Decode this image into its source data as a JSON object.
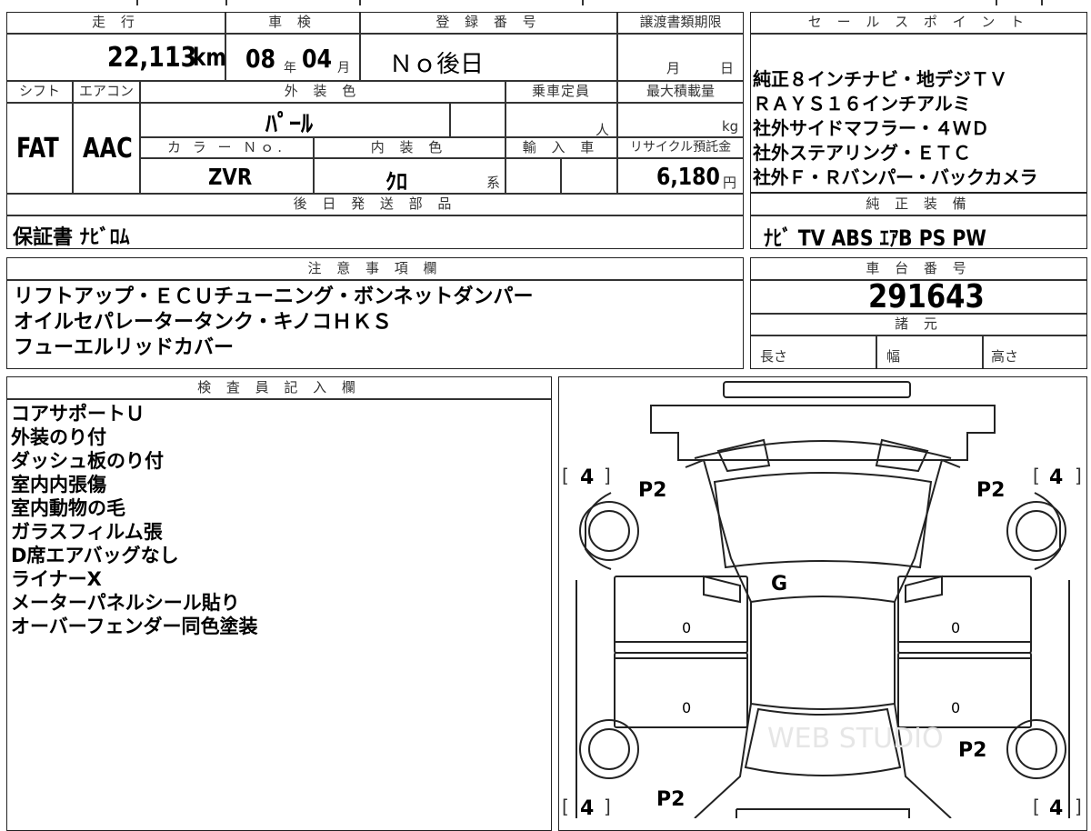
{
  "header": {
    "mileage_label": "走 行",
    "inspection_label": "車 検",
    "registration_label": "登 録 番 号",
    "transfer_deadline_label": "譲渡書類期限",
    "sales_points_label": "セ ー ル ス ポ イ ン ト"
  },
  "vehicle": {
    "mileage": "22,113",
    "mileage_unit": "km",
    "inspection_year": "08",
    "inspection_year_unit": "年",
    "inspection_month": "04",
    "inspection_month_unit": "月",
    "registration": "Ｎｏ後日",
    "transfer_month_unit": "月",
    "transfer_day_unit": "日"
  },
  "specs": {
    "shift_label": "シフト",
    "aircon_label": "エアコン",
    "exterior_color_label": "外 装 色",
    "capacity_label": "乗車定員",
    "max_load_label": "最大積載量",
    "shift": "FAT",
    "aircon": "AAC",
    "exterior_color": "ﾊﾟｰﾙ",
    "capacity_unit": "人",
    "max_load_unit": "kg",
    "color_no_label": "カ ラ ー Ｎｏ.",
    "interior_color_label": "内 装 色",
    "import_label": "輸 入 車",
    "recycle_label": "リサイクル預託金",
    "color_no": "ZVR",
    "interior_color": "ｸﾛ",
    "interior_suffix": "系",
    "recycle_fee": "6,180",
    "recycle_unit": "円"
  },
  "sales_points": [
    "純正８インチナビ・地デジＴＶ",
    "ＲＡＹＳ１６インチアルミ",
    "社外サイドマフラー・４ＷＤ",
    "社外ステアリング・ＥＴＣ",
    "社外Ｆ・Ｒバンパー・バックカメラ"
  ],
  "later_parts": {
    "label": "後 日 発 送 部 品",
    "value": "保証書 ﾅﾋﾞﾛﾑ"
  },
  "factory_equipment": {
    "label": "純 正 装 備",
    "value": "ﾅﾋﾞ TV ABS ｴｱB PS PW"
  },
  "notes": {
    "label": "注 意 事 項 欄",
    "lines": [
      "リフトアップ・ＥＣＵチューニング・ボンネットダンパー",
      "オイルセパレータータンク・キノコＨＫＳ",
      "フューエルリッドカバー"
    ]
  },
  "chassis": {
    "label": "車 台 番 号",
    "number": "291643"
  },
  "dimensions": {
    "label": "諸 元",
    "length_label": "長さ",
    "width_label": "幅",
    "height_label": "高さ"
  },
  "inspector": {
    "label": "検 査 員 記 入 欄",
    "lines": [
      "コアサポートＵ",
      "外装のり付",
      "ダッシュ板のり付",
      "室内内張傷",
      "室内動物の毛",
      "ガラスフィルム張",
      "D席エアバッグなし",
      "ライナーX",
      "メーターパネルシール貼り",
      "オーバーフェンダー同色塗装"
    ]
  },
  "diagram": {
    "tire_fl": "4",
    "tire_fr": "4",
    "tire_rl": "4",
    "tire_rr": "4",
    "mark_fl": "P2",
    "mark_fr": "P2",
    "mark_rl": "P2",
    "mark_rr": "P2",
    "mark_windshield": "G",
    "door_fl": "0",
    "door_fr": "0",
    "door_rl": "0",
    "door_rr": "0",
    "watermark": "WEB STUDIO"
  }
}
